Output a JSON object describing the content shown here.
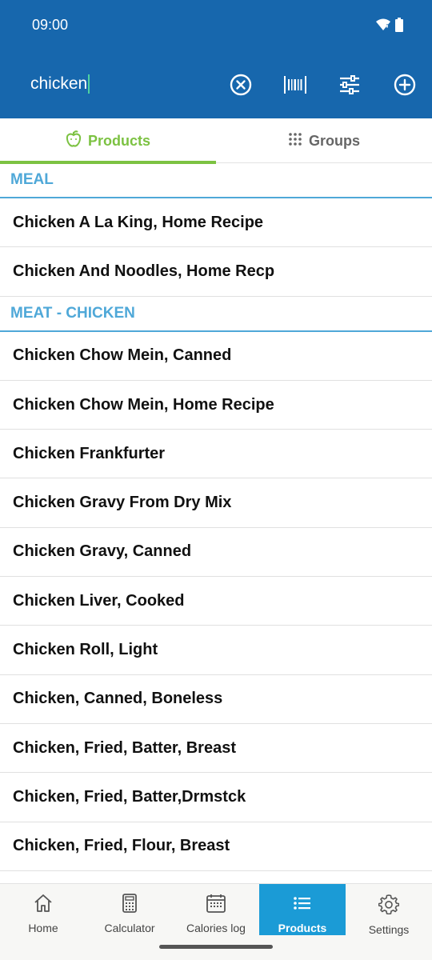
{
  "status_bar": {
    "time": "09:00"
  },
  "search": {
    "query": "chicken"
  },
  "toolbar": {
    "clear_icon": "close-circle-icon",
    "barcode_icon": "barcode-icon",
    "filter_icon": "filter-sliders-icon",
    "add_icon": "add-circle-icon"
  },
  "tabs": [
    {
      "label": "Products",
      "icon": "apple-icon",
      "active": true
    },
    {
      "label": "Groups",
      "icon": "grid-dots-icon",
      "active": false
    }
  ],
  "sections": [
    {
      "title": "MEAL",
      "items": [
        "Chicken A La King, Home Recipe",
        "Chicken And Noodles, Home Recp"
      ]
    },
    {
      "title": "MEAT - CHICKEN",
      "items": [
        "Chicken Chow Mein, Canned",
        "Chicken Chow Mein, Home Recipe",
        "Chicken Frankfurter",
        "Chicken Gravy From Dry Mix",
        "Chicken Gravy, Canned",
        "Chicken Liver, Cooked",
        "Chicken Roll, Light",
        "Chicken, Canned, Boneless",
        "Chicken, Fried, Batter, Breast",
        "Chicken, Fried, Batter,Drmstck",
        "Chicken, Fried, Flour, Breast"
      ]
    }
  ],
  "bottom_nav": [
    {
      "label": "Home",
      "icon": "home-icon"
    },
    {
      "label": "Calculator",
      "icon": "calculator-icon"
    },
    {
      "label": "Calories log",
      "icon": "calendar-icon"
    },
    {
      "label": "Products",
      "icon": "list-icon",
      "active": true
    },
    {
      "label": "Settings",
      "icon": "gear-icon"
    }
  ],
  "colors": {
    "app_bar": "#1767AD",
    "tab_active": "#7CC242",
    "section_header": "#4FA8D8",
    "nav_active": "#1B9BD6"
  }
}
